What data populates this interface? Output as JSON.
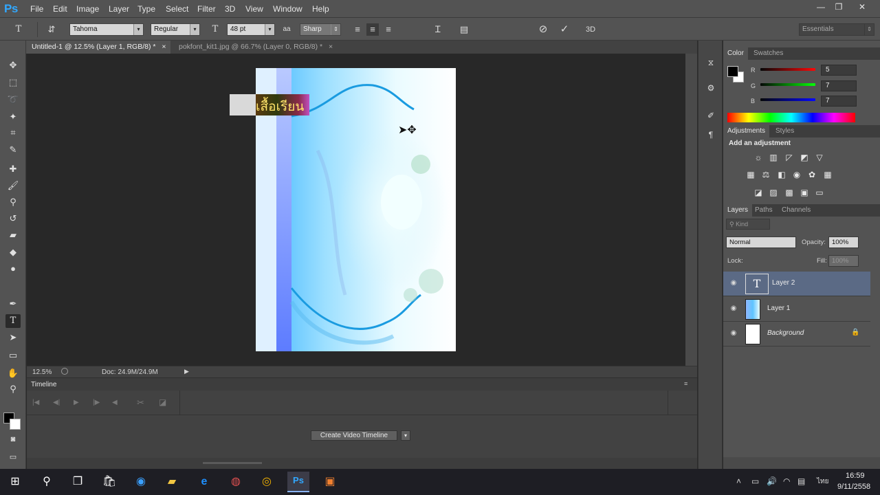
{
  "app": {
    "logo": "Ps",
    "menu": [
      "File",
      "Edit",
      "Image",
      "Layer",
      "Type",
      "Select",
      "Filter",
      "3D",
      "View",
      "Window",
      "Help"
    ]
  },
  "options": {
    "font_family": "Tahoma",
    "font_style": "Regular",
    "font_size": "48 pt",
    "antialias": "Sharp",
    "text_color": "#5a1eff",
    "workspace": "Essentials",
    "three_d": "3D"
  },
  "tabs": [
    {
      "label": "Untitled-1 @ 12.5% (Layer 1, RGB/8) *",
      "active": true
    },
    {
      "label": "pokfont_kit1.jpg @ 66.7% (Layer 0, RGB/8) *",
      "active": false
    }
  ],
  "canvas": {
    "thai_text": "เสื้อเรียน"
  },
  "status": {
    "zoom": "12.5%",
    "doc": "Doc: 24.9M/24.9M"
  },
  "timeline": {
    "title": "Timeline",
    "create_button": "Create Video Timeline"
  },
  "color_panel": {
    "tabs": [
      "Color",
      "Swatches"
    ],
    "channels": [
      {
        "label": "R",
        "value": "5"
      },
      {
        "label": "G",
        "value": "7"
      },
      {
        "label": "B",
        "value": "7"
      }
    ]
  },
  "adjustments_panel": {
    "tabs": [
      "Adjustments",
      "Styles"
    ],
    "heading": "Add an adjustment"
  },
  "layers_panel": {
    "tabs": [
      "Layers",
      "Paths",
      "Channels"
    ],
    "kind_label": "Kind",
    "blend_mode": "Normal",
    "opacity_label": "Opacity:",
    "opacity_value": "100%",
    "lock_label": "Lock:",
    "fill_label": "Fill:",
    "fill_value": "100%",
    "layers": [
      {
        "name": "Layer 2",
        "type": "text",
        "selected": true
      },
      {
        "name": "Layer 1",
        "type": "image",
        "selected": false
      },
      {
        "name": "Background",
        "type": "background",
        "selected": false
      }
    ]
  },
  "taskbar": {
    "time": "16:59",
    "date": "9/11/2558",
    "lang": "ไทย"
  },
  "colors": {
    "accent_blue": "#31a8ff",
    "selected_layer": "#5b6a85"
  }
}
